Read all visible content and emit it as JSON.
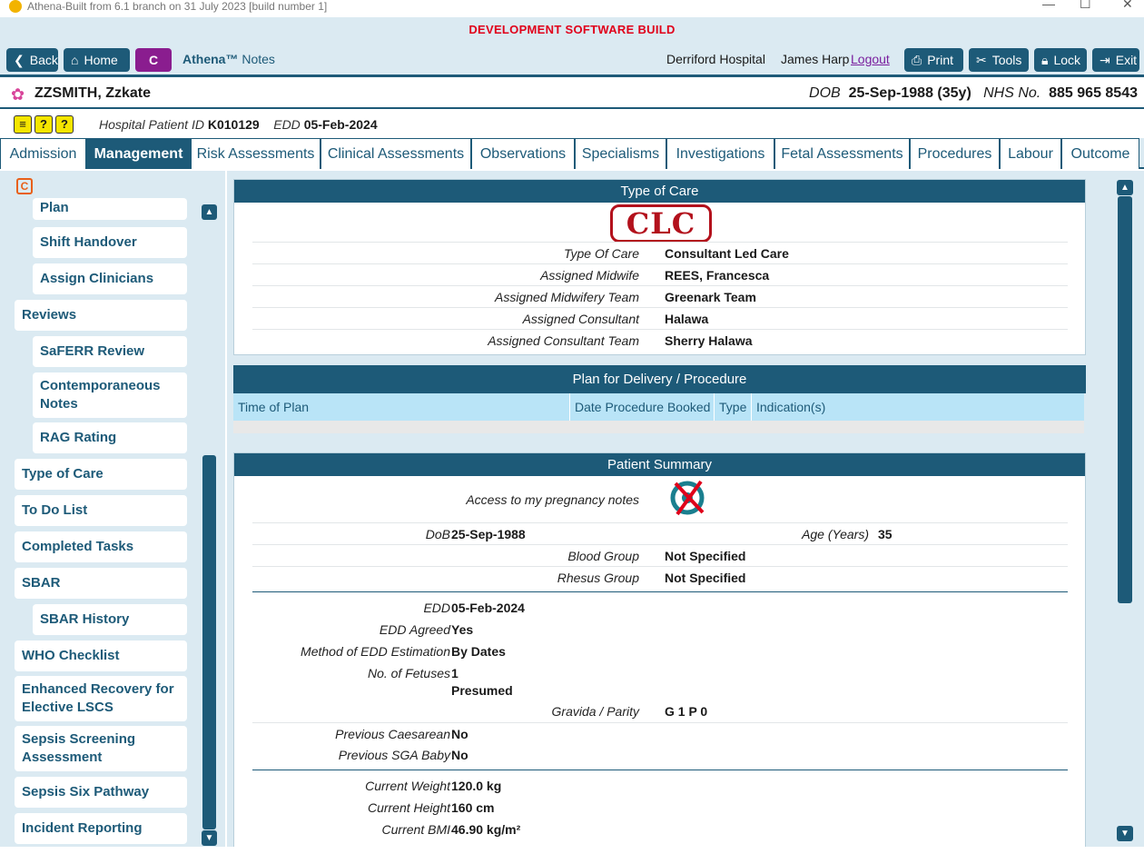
{
  "window": {
    "title": "Athena-Built from 6.1 branch on 31 July 2023 [build number 1]",
    "min": "—",
    "max": "☐",
    "close": "✕"
  },
  "banner": "DEVELOPMENT SOFTWARE BUILD",
  "toolbar": {
    "back": "Back",
    "home": "Home",
    "c": "C",
    "app_brand": "Athena™",
    "app_section": "Notes",
    "hospital": "Derriford Hospital",
    "user": "James Harp",
    "logout": "Logout",
    "print": "Print",
    "tools": "Tools",
    "lock": "Lock",
    "exit": "Exit"
  },
  "patient": {
    "name": "ZZSMITH, Zzkate",
    "dob_label": "DOB",
    "dob": "25-Sep-1988 (35y)",
    "nhs_label": "NHS No.",
    "nhs": "885 965 8543",
    "hospital_id_label": "Hospital Patient ID",
    "hospital_id": "K010129",
    "edd_label": "EDD",
    "edd": "05-Feb-2024"
  },
  "tabs": [
    "Admission",
    "Management",
    "Risk Assessments",
    "Clinical Assessments",
    "Observations",
    "Specialisms",
    "Investigations",
    "Fetal Assessments",
    "Procedures",
    "Labour",
    "Outcome"
  ],
  "nav": {
    "plan": "Plan",
    "shift_handover": "Shift Handover",
    "assign_clinicians": "Assign Clinicians",
    "reviews": "Reviews",
    "saferr": "SaFERR Review",
    "contemp_1": "Contemporaneous",
    "contemp_2": "Notes",
    "rag": "RAG Rating",
    "type_of_care": "Type of Care",
    "todo": "To Do List",
    "completed": "Completed Tasks",
    "sbar": "SBAR",
    "sbar_history": "SBAR History",
    "who": "WHO Checklist",
    "enhanced_1": "Enhanced Recovery for",
    "enhanced_2": "Elective LSCS",
    "sepsis_1": "Sepsis Screening",
    "sepsis_2": "Assessment",
    "sepsis_six": "Sepsis Six Pathway",
    "incident": "Incident Reporting"
  },
  "type_of_care": {
    "title": "Type of Care",
    "stamp": "CLC",
    "type_label": "Type Of Care",
    "type": "Consultant Led Care",
    "midwife_label": "Assigned Midwife",
    "midwife": "REES, Francesca",
    "mw_team_label": "Assigned Midwifery Team",
    "mw_team": "Greenark Team",
    "consultant_label": "Assigned Consultant",
    "consultant": "Halawa",
    "cons_team_label": "Assigned Consultant Team",
    "cons_team": "Sherry Halawa"
  },
  "plan_delivery": {
    "title": "Plan for Delivery / Procedure",
    "cols": [
      "Time of Plan",
      "Date Procedure Booked",
      "Type",
      "Indication(s)"
    ]
  },
  "summary": {
    "title": "Patient Summary",
    "access_label": "Access to my pregnancy notes",
    "dob_label": "DoB",
    "dob": "25-Sep-1988",
    "age_label": "Age (Years)",
    "age": "35",
    "blood_label": "Blood Group",
    "blood": "Not Specified",
    "rhesus_label": "Rhesus Group",
    "rhesus": "Not Specified",
    "edd_label": "EDD",
    "edd": "05-Feb-2024",
    "edd_agreed_label": "EDD Agreed",
    "edd_agreed": "Yes",
    "method_label": "Method of EDD Estimation",
    "method": "By Dates",
    "fetuses_label": "No. of Fetuses",
    "fetuses": "1",
    "fetuses_note": "Presumed",
    "gravida_label": "Gravida / Parity",
    "gravida": "G 1 P 0",
    "prev_c_label": "Previous Caesarean",
    "prev_c": "No",
    "prev_sga_label": "Previous SGA Baby",
    "prev_sga": "No",
    "weight_label": "Current Weight",
    "weight": "120.0 kg",
    "height_label": "Current Height",
    "height": "160 cm",
    "bmi_label": "Current BMI",
    "bmi": "46.90 kg/m²"
  },
  "colors": {
    "primary": "#1d5a78",
    "panel_bg": "#dbeaf2",
    "banner_red": "#e0001a",
    "c_button": "#8a1d8f",
    "stamp": "#b3111c"
  }
}
